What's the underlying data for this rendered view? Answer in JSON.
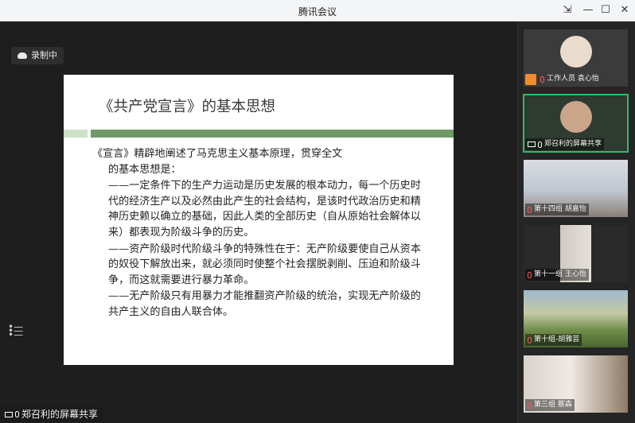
{
  "window": {
    "title": "腾讯会议"
  },
  "recording": {
    "label": "录制中"
  },
  "slide": {
    "title": "《共产党宣言》的基本思想",
    "intro_line1": "《宣言》精辟地阐述了马克思主义基本原理，贯穿全文",
    "intro_line2": "的基本思想是：",
    "points": [
      "——一定条件下的生产力运动是历史发展的根本动力，每一个历史时代的经济生产以及必然由此产生的社会结构，是该时代政治历史和精神历史赖以确立的基础，因此人类的全部历史（自从原始社会解体以来）都表现为阶级斗争的历史。",
      "——资产阶级时代阶级斗争的特殊性在于：无产阶级要使自己从资本的奴役下解放出来，就必须同时使整个社会摆脱剥削、压迫和阶级斗争，而这就需要进行暴力革命。",
      "——无产阶级只有用暴力才能推翻资产阶级的统治，实现无产阶级的共产主义的自由人联合体。"
    ]
  },
  "share": {
    "label": "郑召利的屏幕共享"
  },
  "participants": [
    {
      "name": "工作人员 袁心怡",
      "mic_muted": true
    },
    {
      "name": "郑召利的屏幕共享",
      "mic_muted": false
    },
    {
      "name": "第十四组 胡嘉怡",
      "mic_muted": true
    },
    {
      "name": "第十一组 王心怡",
      "mic_muted": true
    },
    {
      "name": "第十组-胡雅芸",
      "mic_muted": true
    },
    {
      "name": "第三组 蔡森",
      "mic_muted": true
    }
  ],
  "colors": {
    "slide_bar_dark": "#6f9a67",
    "slide_bar_light": "#cfe0c8",
    "active_tile_border": "#35b86b",
    "muted_mic": "#ff5a5a"
  }
}
